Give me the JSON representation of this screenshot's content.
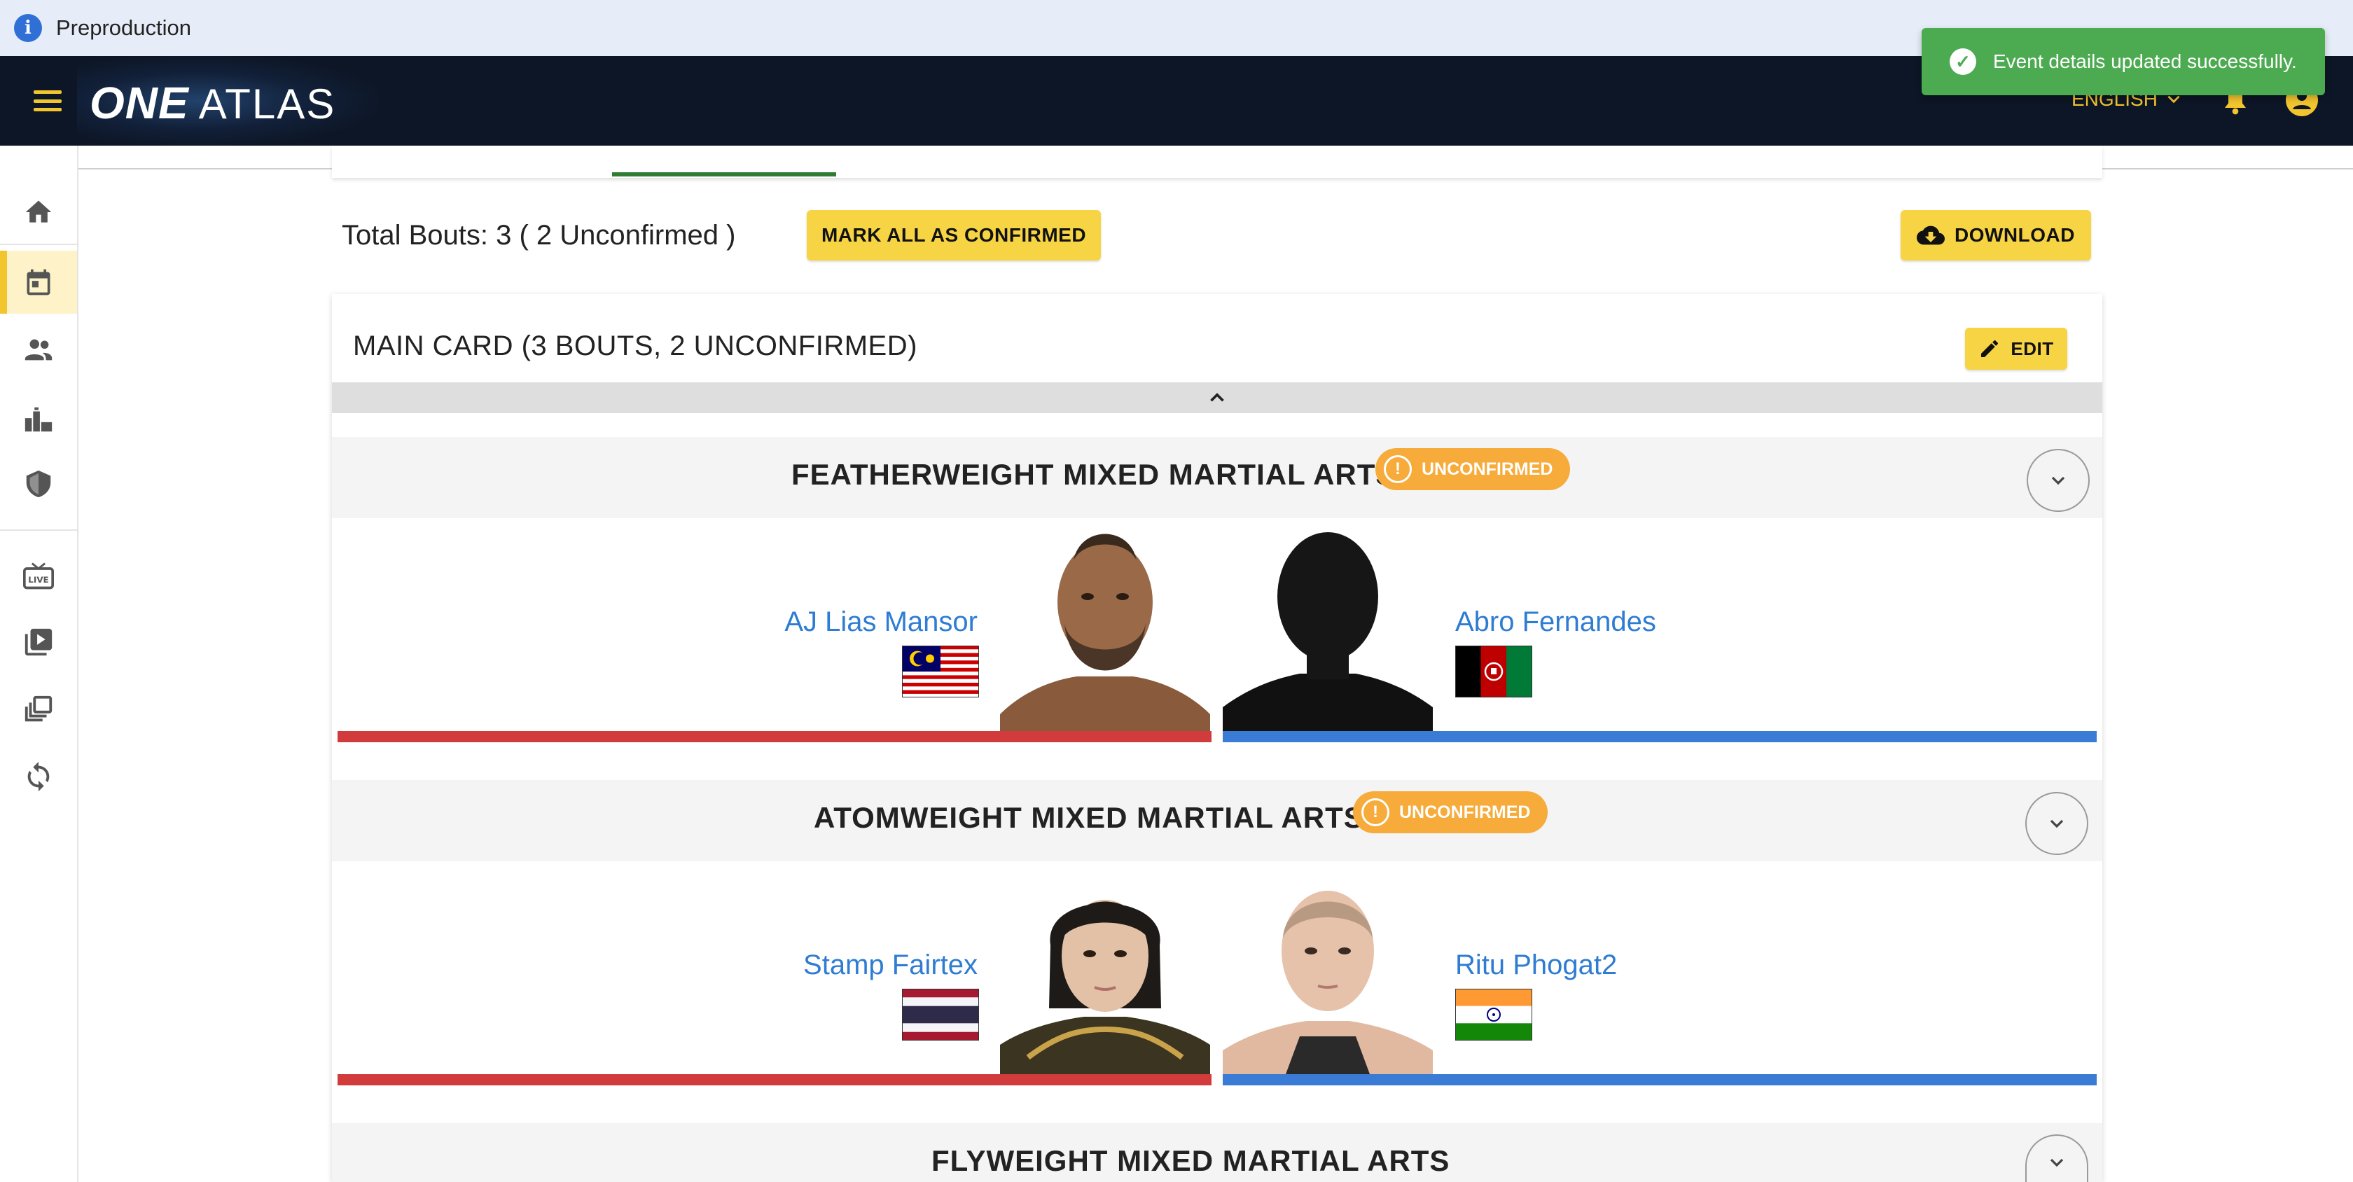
{
  "environment": {
    "label": "Preproduction"
  },
  "app": {
    "logo_one": "ONE",
    "logo_atlas": "ATLAS",
    "language": "ENGLISH"
  },
  "toast": {
    "message": "Event details updated successfully."
  },
  "sidebar": {
    "items": [
      {
        "icon": "home-icon"
      },
      {
        "icon": "calendar-icon",
        "active": true
      },
      {
        "icon": "people-icon"
      },
      {
        "icon": "venue-icon"
      },
      {
        "icon": "shield-icon"
      },
      {
        "icon": "live-tv-icon"
      },
      {
        "icon": "video-library-icon"
      },
      {
        "icon": "collections-icon"
      },
      {
        "icon": "sync-icon"
      }
    ]
  },
  "summary": {
    "total_bouts": "Total Bouts: 3 ( 2 Unconfirmed )",
    "mark_all_label": "MARK ALL AS CONFIRMED",
    "download_label": "DOWNLOAD"
  },
  "main_card": {
    "title": "MAIN CARD (3 BOUTS, 2 UNCONFIRMED)",
    "edit_label": "EDIT",
    "bouts": [
      {
        "title": "FEATHERWEIGHT  MIXED MARTIAL ARTS",
        "status": "UNCONFIRMED",
        "red": {
          "name": "AJ Lias Mansor",
          "flag": "Malaysia"
        },
        "blue": {
          "name": "Abro Fernandes",
          "flag": "Afghanistan"
        }
      },
      {
        "title": "ATOMWEIGHT  MIXED MARTIAL ARTS",
        "status": "UNCONFIRMED",
        "red": {
          "name": "Stamp Fairtex",
          "flag": "Thailand"
        },
        "blue": {
          "name": "Ritu Phogat2",
          "flag": "India"
        }
      },
      {
        "title": "FLYWEIGHT  MIXED MARTIAL ARTS"
      }
    ]
  },
  "colors": {
    "accent": "#f7d444",
    "app_bar": "#0d1626",
    "toast": "#4caa50",
    "badge": "#f6ab3a",
    "red_corner": "#d23b3b",
    "blue_corner": "#3a7bd5",
    "fighter_link": "#2f7cd3"
  }
}
